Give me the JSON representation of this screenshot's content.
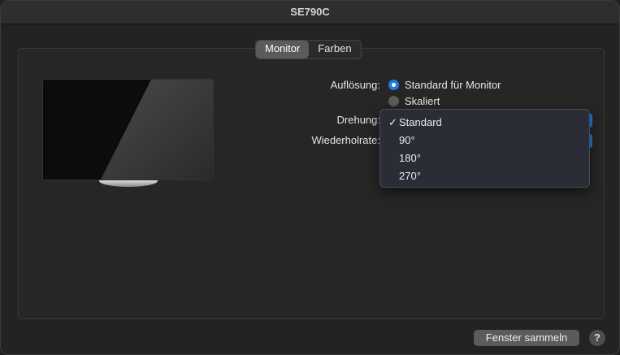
{
  "window": {
    "title": "SE790C"
  },
  "tabs": [
    {
      "label": "Monitor",
      "selected": true
    },
    {
      "label": "Farben",
      "selected": false
    }
  ],
  "resolution": {
    "label": "Auflösung:",
    "options": [
      {
        "label": "Standard für Monitor",
        "selected": true
      },
      {
        "label": "Skaliert",
        "selected": false
      }
    ]
  },
  "rotation": {
    "label": "Drehung:",
    "menu": [
      {
        "label": "Standard",
        "checked": true,
        "check": "✓"
      },
      {
        "label": "90°",
        "checked": false,
        "check": ""
      },
      {
        "label": "180°",
        "checked": false,
        "check": ""
      },
      {
        "label": "270°",
        "checked": false,
        "check": ""
      }
    ]
  },
  "refresh_rate": {
    "label": "Wiederholrate:"
  },
  "footer": {
    "gather_windows_label": "Fenster sammeln",
    "help_label": "?"
  },
  "colors": {
    "accent": "#1f7ae0",
    "window_bg": "#232323",
    "menu_bg": "#2a2d35"
  },
  "icons": {
    "monitor": "monitor-illustration",
    "check": "checkmark-icon",
    "help": "help-icon"
  }
}
